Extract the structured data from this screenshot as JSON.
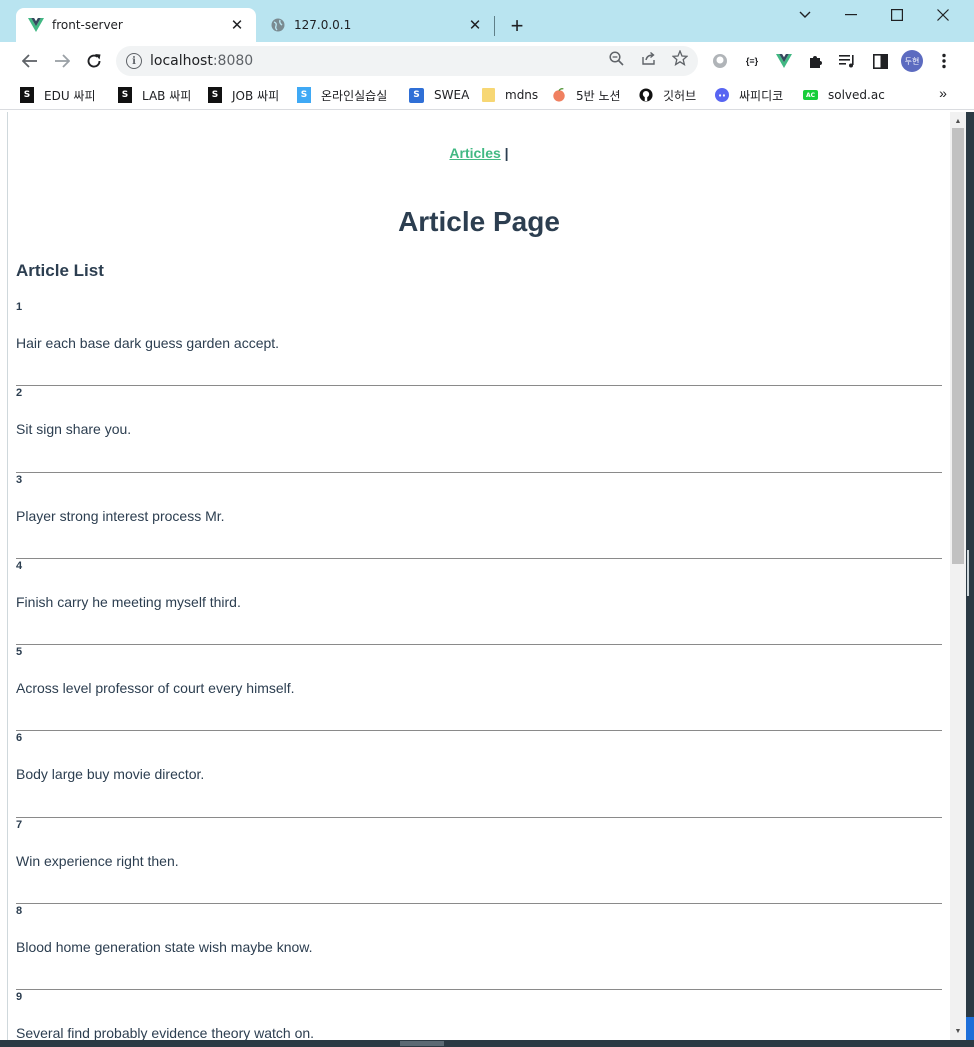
{
  "browser": {
    "tabs": [
      {
        "title": "front-server",
        "active": true,
        "icon": "vue-logo-icon"
      },
      {
        "title": "127.0.0.1",
        "active": false,
        "icon": "globe-icon"
      }
    ],
    "address": {
      "host": "localhost",
      "port": ":8080"
    },
    "bookmarks": [
      {
        "label": "EDU 싸피",
        "icon": "ssafy-icon"
      },
      {
        "label": "LAB 싸피",
        "icon": "ssafy-icon"
      },
      {
        "label": "JOB 싸피",
        "icon": "ssafy-icon"
      },
      {
        "label": "온라인실습실",
        "icon": "ssafy-blue-icon"
      },
      {
        "label": "SWEA",
        "icon": "swea-icon"
      },
      {
        "label": "mdns",
        "icon": "folder-icon"
      },
      {
        "label": "5반 노션",
        "icon": "peach-icon"
      },
      {
        "label": "깃허브",
        "icon": "github-icon"
      },
      {
        "label": "싸피디코",
        "icon": "discord-icon"
      },
      {
        "label": "solved.ac",
        "icon": "solvedac-icon"
      }
    ],
    "bookmarks_more": "»",
    "profile_label": "두현",
    "extension_label": "{≡}"
  },
  "page": {
    "nav_link": "Articles",
    "nav_separator": " |",
    "title": "Article Page",
    "list_title": "Article List",
    "articles": [
      {
        "id": "1",
        "text": "Hair each base dark guess garden accept."
      },
      {
        "id": "2",
        "text": "Sit sign share you."
      },
      {
        "id": "3",
        "text": "Player strong interest process Mr."
      },
      {
        "id": "4",
        "text": "Finish carry he meeting myself third."
      },
      {
        "id": "5",
        "text": "Across level professor of court every himself."
      },
      {
        "id": "6",
        "text": "Body large buy movie director."
      },
      {
        "id": "7",
        "text": "Win experience right then."
      },
      {
        "id": "8",
        "text": "Blood home generation state wish maybe know."
      },
      {
        "id": "9",
        "text": "Several find probably evidence theory watch on."
      }
    ]
  },
  "colors": {
    "tabstrip": "#b9e4f0",
    "link": "#42b983",
    "text": "#2c3e50"
  }
}
